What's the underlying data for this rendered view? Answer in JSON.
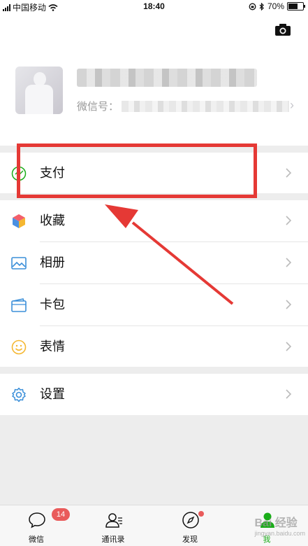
{
  "status_bar": {
    "carrier": "中国移动",
    "time": "18:40",
    "battery": "70%",
    "battery_level": 0.7
  },
  "profile": {
    "wechat_id_label": "微信号："
  },
  "menu": {
    "pay": "支付",
    "favorites": "收藏",
    "album": "相册",
    "cards": "卡包",
    "stickers": "表情",
    "settings": "设置"
  },
  "tabbar": {
    "chats": {
      "label": "微信",
      "badge": "14"
    },
    "contacts": {
      "label": "通讯录"
    },
    "discover": {
      "label": "发现"
    },
    "me": {
      "label": "我"
    }
  },
  "watermark": {
    "text": "Bai 经验",
    "sub": "jingyan.baidu.com"
  },
  "colors": {
    "annotation": "#e53935",
    "accent": "#1aad19",
    "badge": "#e95b5b"
  }
}
